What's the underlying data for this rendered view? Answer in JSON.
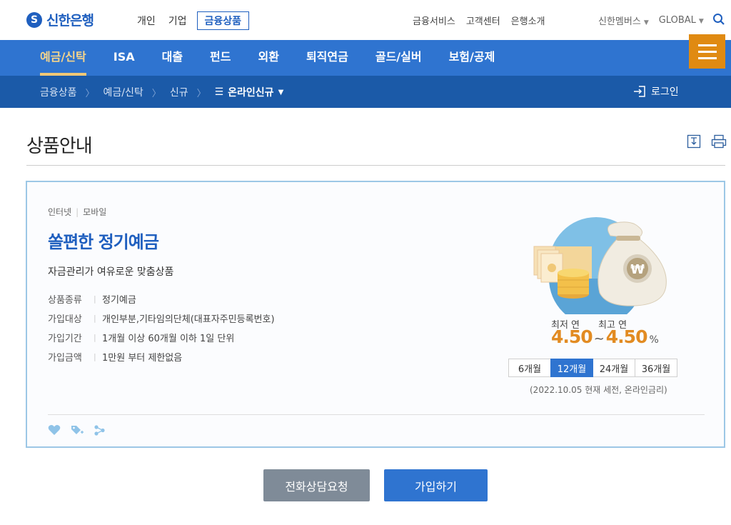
{
  "header": {
    "logo_text": "신한은행",
    "logo_mark": "S",
    "nav": [
      "개인",
      "기업",
      "금융상품"
    ],
    "active_nav": "금융상품",
    "utility": [
      "금융서비스",
      "고객센터",
      "은행소개"
    ],
    "member_label": "신한멤버스",
    "global_label": "GLOBAL",
    "search_icon": "search-icon"
  },
  "gnb": {
    "items": [
      "예금/신탁",
      "ISA",
      "대출",
      "펀드",
      "외환",
      "퇴직연금",
      "골드/실버",
      "보험/공제"
    ],
    "active_item": "예금/신탁",
    "menu_icon": "hamburger-menu-icon"
  },
  "breadcrumb": {
    "items": [
      "금융상품",
      "예금/신탁",
      "신규"
    ],
    "current": "온라인신규",
    "login_label": "로그인"
  },
  "page": {
    "title": "상품안내",
    "tools": [
      "download-icon",
      "print-icon"
    ]
  },
  "product": {
    "channels": [
      "인터넷",
      "모바일"
    ],
    "name": "쏠편한 정기예금",
    "description": "자금관리가 여유로운 맞춤상품",
    "specs": [
      {
        "label": "상품종류",
        "value": "정기예금"
      },
      {
        "label": "가입대상",
        "value": "개인부분,기타임의단체(대표자주민등록번호)"
      },
      {
        "label": "가입기간",
        "value": "1개월 이상 60개월 이하 1일 단위"
      },
      {
        "label": "가입금액",
        "value": "1만원 부터 제한없음"
      }
    ],
    "rate_min_label": "최저 연",
    "rate_max_label": "최고 연",
    "rate_min": "4.50",
    "rate_max": "4.50",
    "rate_separator": "~",
    "rate_unit": "%",
    "periods": [
      "6개월",
      "12개월",
      "24개월",
      "36개월"
    ],
    "active_period": "12개월",
    "rate_note": "(2022.10.05 현재 세전, 온라인금리)",
    "action_icons": [
      "heart-icon",
      "tag-add-icon",
      "share-icon"
    ]
  },
  "buttons": {
    "consult": "전화상담요청",
    "join": "가입하기"
  },
  "colors": {
    "brand_blue": "#2f74d0",
    "dark_blue": "#1b5aa8",
    "accent_orange": "#e08a12",
    "rate_orange": "#e28b22",
    "card_border": "#9cc7e6"
  }
}
